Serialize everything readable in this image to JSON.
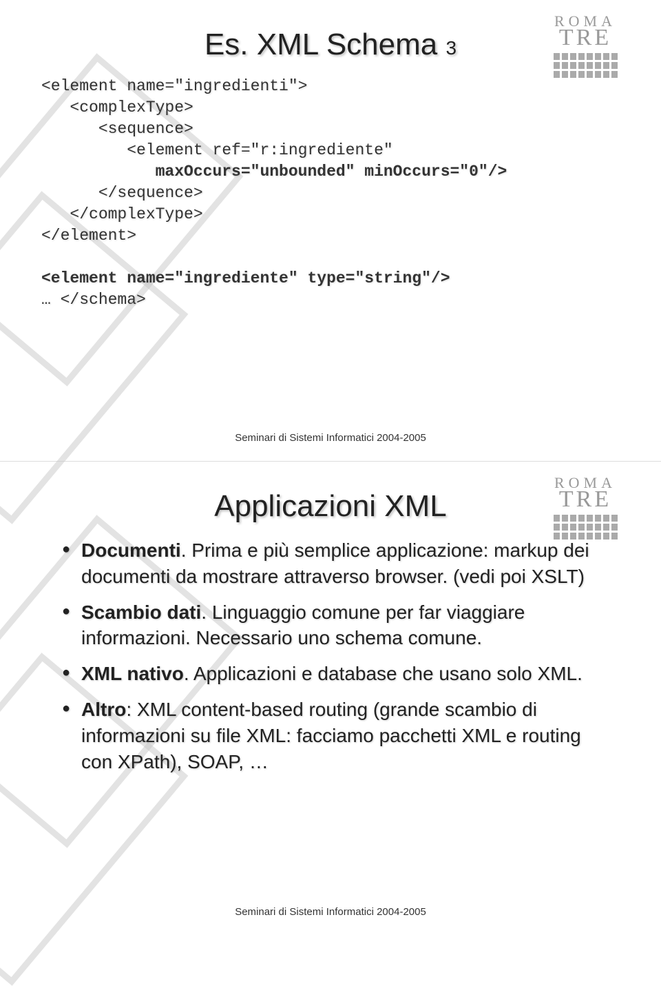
{
  "logo": {
    "line1": "ROMA",
    "line2": "TRE"
  },
  "footer": "Seminari di Sistemi Informatici 2004-2005",
  "slide1": {
    "title": "Es. XML Schema",
    "title_sub": "3",
    "code_l1": "<element name=\"ingredienti\">",
    "code_l2": "   <complexType>",
    "code_l3": "      <sequence>",
    "code_l4": "         <element ref=\"r:ingrediente\"",
    "code_l5": "            maxOccurs=\"unbounded\" minOccurs=\"0\"/>",
    "code_l6": "      </sequence>",
    "code_l7": "   </complexType>",
    "code_l8": "</element>",
    "code_l9": "<element name=\"ingrediente\" type=\"string\"/>",
    "code_l10": "… </schema>"
  },
  "slide2": {
    "title": "Applicazioni XML",
    "b1_strong": "Documenti",
    "b1_rest": ". Prima e più semplice applicazione: markup dei documenti da mostrare attraverso browser. (vedi poi XSLT)",
    "b2_strong": "Scambio dati",
    "b2_rest": ". Linguaggio comune per far viaggiare informazioni. Necessario uno schema comune.",
    "b3_strong": "XML nativo",
    "b3_rest": ". Applicazioni e database che usano solo XML.",
    "b4_strong": "Altro",
    "b4_rest": ": XML content-based routing (grande scambio di informazioni su file XML: facciamo pacchetti XML e routing con XPath), SOAP, …"
  }
}
